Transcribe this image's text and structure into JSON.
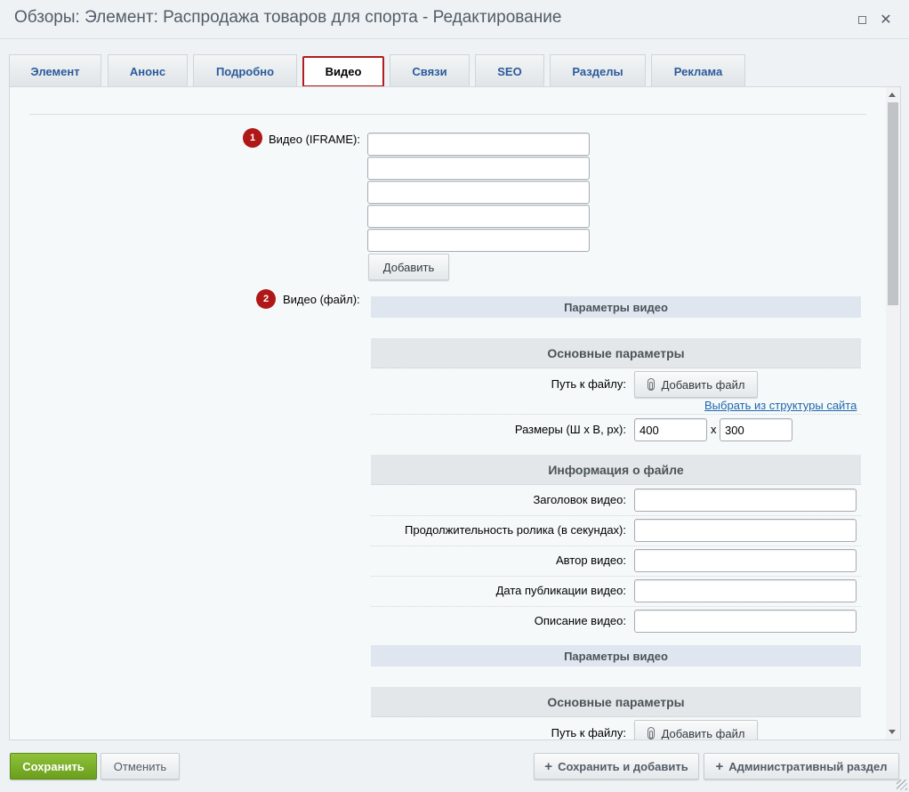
{
  "window": {
    "title": "Обзоры: Элемент: Распродажа товаров для спорта - Редактирование"
  },
  "tabs": [
    {
      "label": "Элемент"
    },
    {
      "label": "Анонс"
    },
    {
      "label": "Подробно"
    },
    {
      "label": "Видео",
      "active": true
    },
    {
      "label": "Связи"
    },
    {
      "label": "SEO"
    },
    {
      "label": "Разделы"
    },
    {
      "label": "Реклама"
    }
  ],
  "iframe_section": {
    "badge": "1",
    "label": "Видео (IFRAME):",
    "inputs": [
      "",
      "",
      "",
      "",
      ""
    ],
    "add_button": "Добавить"
  },
  "file_section": {
    "badge": "2",
    "label": "Видео (файл):",
    "blocks": [
      {
        "params_header": "Параметры видео",
        "main_params_header": "Основные параметры",
        "file_path_label": "Путь к файлу:",
        "add_file_button": "Добавить файл",
        "site_structure_link": "Выбрать из структуры сайта",
        "size_label": "Размеры (Ш x В, px):",
        "width": "400",
        "times": "x",
        "height": "300",
        "file_info_header": "Информация о файле",
        "fields": [
          {
            "label": "Заголовок видео:",
            "value": ""
          },
          {
            "label": "Продолжительность ролика (в секундах):",
            "value": ""
          },
          {
            "label": "Автор видео:",
            "value": ""
          },
          {
            "label": "Дата публикации видео:",
            "value": ""
          },
          {
            "label": "Описание видео:",
            "value": ""
          }
        ]
      },
      {
        "params_header": "Параметры видео",
        "main_params_header": "Основные параметры",
        "file_path_label": "Путь к файлу:",
        "add_file_button": "Добавить файл"
      }
    ]
  },
  "footer": {
    "save": "Сохранить",
    "cancel": "Отменить",
    "save_and_add": "Сохранить и добавить",
    "admin_section": "Административный раздел"
  },
  "colors": {
    "accent_red": "#b01717",
    "save_green": "#7bb22b",
    "link_blue": "#2067b0"
  }
}
